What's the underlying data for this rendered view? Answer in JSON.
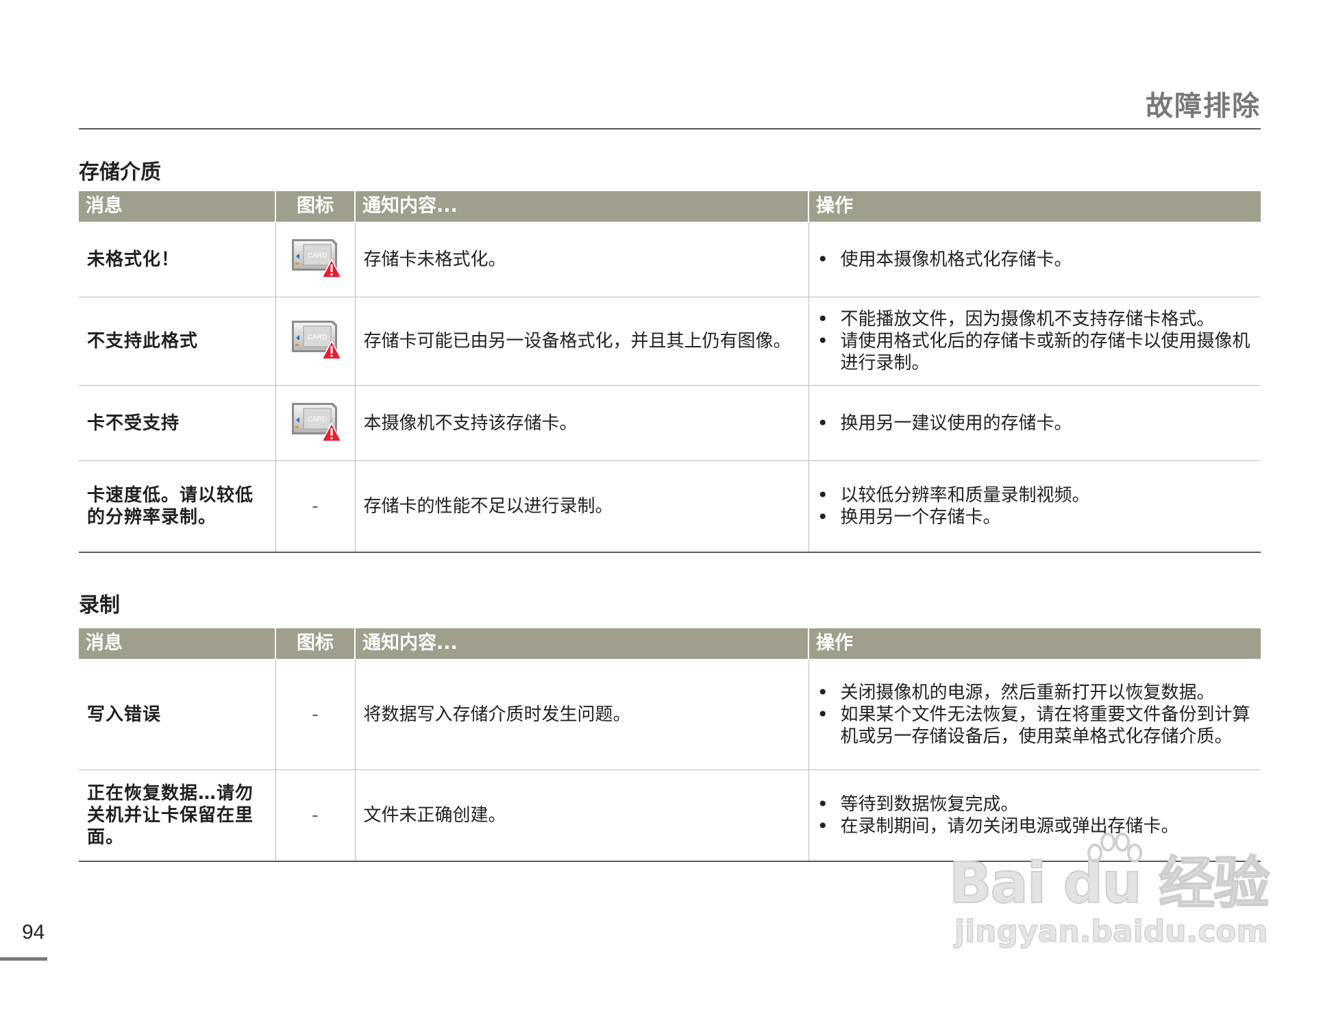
{
  "header": {
    "title": "故障排除"
  },
  "page_number": "94",
  "table_headers": {
    "message": "消息",
    "icon": "图标",
    "content": "通知内容...",
    "action": "操作"
  },
  "icons": {
    "card_icon_label": "CARD",
    "card_warning_icon": "card-warning-icon",
    "no_icon": "-"
  },
  "colors": {
    "header_bg": "#a09f8d",
    "header_text": "#ffffff",
    "warning_red": "#e5202e"
  },
  "sections": [
    {
      "title": "存储介质",
      "rows": [
        {
          "message": "未格式化！",
          "icon": "card",
          "content": "存储卡未格式化。",
          "actions": [
            "使用本摄像机格式化存储卡。"
          ]
        },
        {
          "message": "不支持此格式",
          "icon": "card",
          "content": "存储卡可能已由另一设备格式化，并且其上仍有图像。",
          "actions": [
            "不能播放文件，因为摄像机不支持存储卡格式。",
            "请使用格式化后的存储卡或新的存储卡以使用摄像机进行录制。"
          ]
        },
        {
          "message": "卡不受支持",
          "icon": "card",
          "content": "本摄像机不支持该存储卡。",
          "actions": [
            "换用另一建议使用的存储卡。"
          ]
        },
        {
          "message": "卡速度低。请以较低的分辨率录制。",
          "icon": "-",
          "content": "存储卡的性能不足以进行录制。",
          "actions": [
            "以较低分辨率和质量录制视频。",
            "换用另一个存储卡。"
          ]
        }
      ]
    },
    {
      "title": "录制",
      "rows": [
        {
          "message": "写入错误",
          "icon": "-",
          "content": "将数据写入存储介质时发生问题。",
          "actions": [
            "关闭摄像机的电源，然后重新打开以恢复数据。",
            "如果某个文件无法恢复，请在将重要文件备份到计算机或另一存储设备后，使用菜单格式化存储介质。"
          ]
        },
        {
          "message": "正在恢复数据…请勿关机并让卡保留在里面。",
          "icon": "-",
          "content": "文件未正确创建。",
          "actions": [
            "等待到数据恢复完成。",
            "在录制期间，请勿关闭电源或弹出存储卡。"
          ]
        }
      ]
    }
  ],
  "watermark": {
    "line1": "Bai du 经验",
    "line2": "jingyan.baidu.com"
  }
}
